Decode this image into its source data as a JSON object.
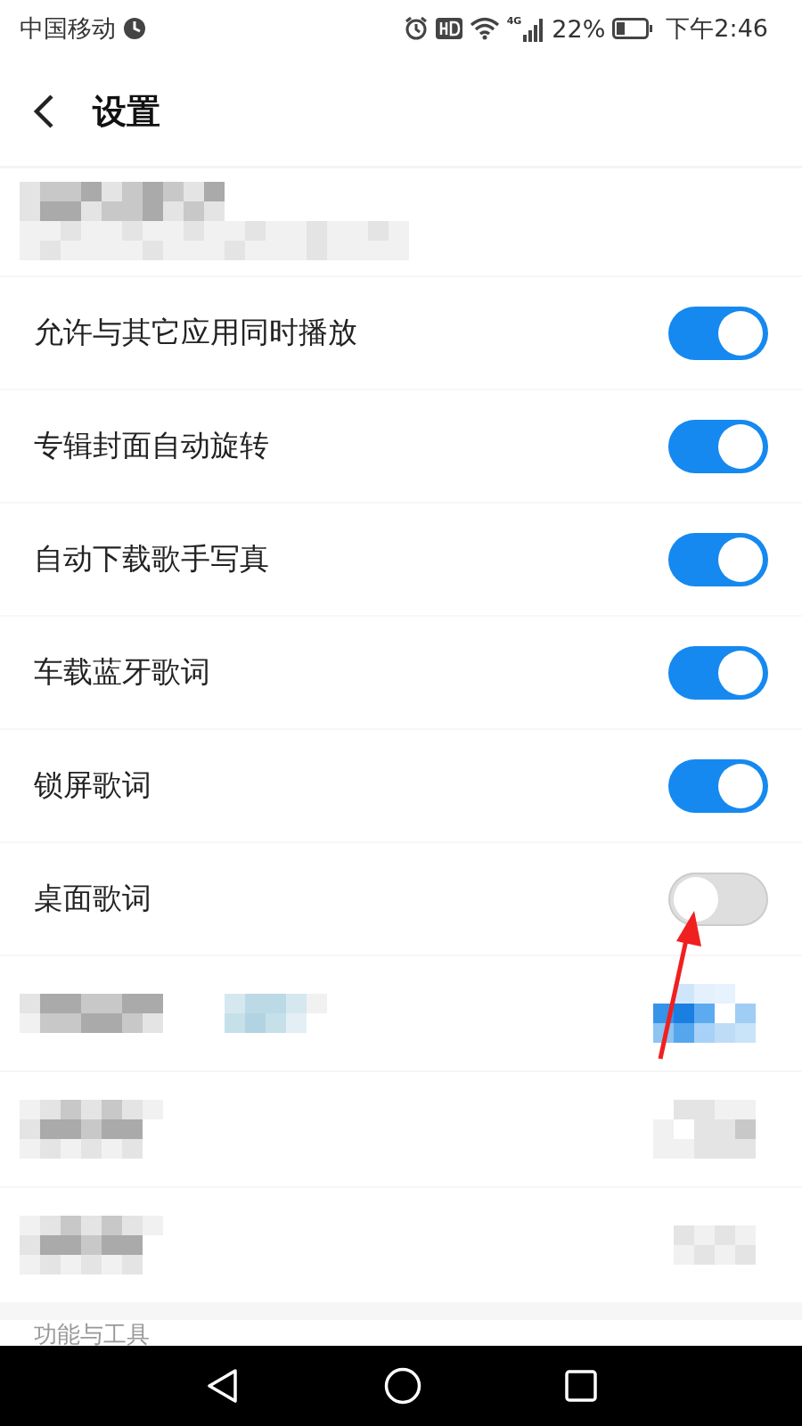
{
  "status_bar": {
    "carrier": "中国移动",
    "battery": "22%",
    "time": "下午2:46",
    "network": "4G"
  },
  "header": {
    "title": "设置"
  },
  "settings": [
    {
      "label": "允许与其它应用同时播放",
      "on": true
    },
    {
      "label": "专辑封面自动旋转",
      "on": true
    },
    {
      "label": "自动下载歌手写真",
      "on": true
    },
    {
      "label": "车载蓝牙歌词",
      "on": true
    },
    {
      "label": "锁屏歌词",
      "on": true
    },
    {
      "label": "桌面歌词",
      "on": false
    }
  ],
  "section": {
    "title": "功能与工具"
  }
}
